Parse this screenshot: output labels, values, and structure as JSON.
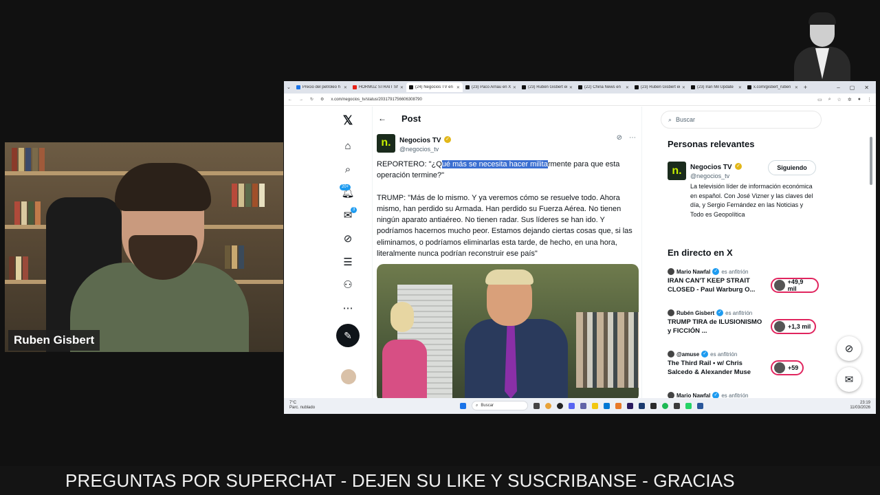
{
  "webcam": {
    "name": "Ruben Gisbert"
  },
  "browser": {
    "tabs": [
      {
        "label": "Precio del petróleo h"
      },
      {
        "label": "HORMUZ STRAIT Sh"
      },
      {
        "label": "(24) Negocios TV en",
        "active": true
      },
      {
        "label": "(23) Paco Arnau en X"
      },
      {
        "label": "(23) Rubén Gisbert en"
      },
      {
        "label": "(22) China News en"
      },
      {
        "label": "(23) Rubén Gisbert en"
      },
      {
        "label": "(23) Iran Mil Update"
      },
      {
        "label": "x.com/gisbert_ruben"
      }
    ],
    "url": "x.com/negocios_tv/status/2031791756606308790"
  },
  "x": {
    "nav": {
      "notifications_badge": "20+",
      "messages_badge": "3"
    },
    "post_header": "Post",
    "author": {
      "name": "Negocios TV",
      "handle": "@negocios_tv",
      "logo": "n."
    },
    "tweet": {
      "p1_pre": "REPORTERO: \"¿Q",
      "p1_hl": "ué más se necesita hacer milita",
      "p1_post": "rmente para que esta operación termine?\"",
      "p2": "TRUMP: \"Más de lo mismo. Y ya veremos cómo se resuelve todo. Ahora mismo, han perdido su Armada. Han perdido su Fuerza Aérea. No tienen ningún aparato antiaéreo. No tienen radar. Sus líderes se han ido. Y podríamos hacernos mucho peor. Estamos dejando ciertas cosas que, si las eliminamos, o podríamos eliminarlas esta tarde, de hecho, en una hora, literalmente nunca podrían reconstruir ese país\""
    },
    "search_placeholder": "Buscar",
    "relevant": {
      "title": "Personas relevantes",
      "name": "Negocios TV",
      "handle": "@negocios_tv",
      "follow_label": "Siguiendo",
      "bio": "La televisión líder de información económica en español. Con José Vizner y las claves del día, y Sergio Fernández en las Noticias y Todo es Geopolítica"
    },
    "live": {
      "title": "En directo en X",
      "items": [
        {
          "host": "Mario Nawfal",
          "role": "es anfitrión",
          "title": "IRAN CAN'T KEEP STRAIT CLOSED - Paul Warburg O...",
          "count": "+49,9 mil"
        },
        {
          "host": "Rubén Gisbert",
          "role": "es anfitrión",
          "title": "TRUMP TIRA de ILUSIONISMO y FICCIÓN ...",
          "count": "+1,3 mil"
        },
        {
          "host": "@amuse",
          "role": "es anfitrión",
          "title": "The Third Rail • w/ Chris Salcedo & Alexander Muse",
          "count": "+59"
        },
        {
          "host": "Mario Nawfal",
          "role": "es anfitrión",
          "title": "",
          "count": ""
        }
      ]
    }
  },
  "taskbar": {
    "weather_temp": "7°C",
    "weather_desc": "Parc. nublado",
    "search_placeholder": "Buscar",
    "time": "23:19",
    "date": "11/03/2026"
  },
  "ticker": "PREGUNTAS POR SUPERCHAT - DEJEN SU LIKE Y SUSCRIBANSE - GRACIAS",
  "colors": {
    "accent": "#1d9bf0",
    "highlight": "#3b6fd1",
    "live_pill": "#e0245e",
    "brand_logo": "#c7f000"
  }
}
